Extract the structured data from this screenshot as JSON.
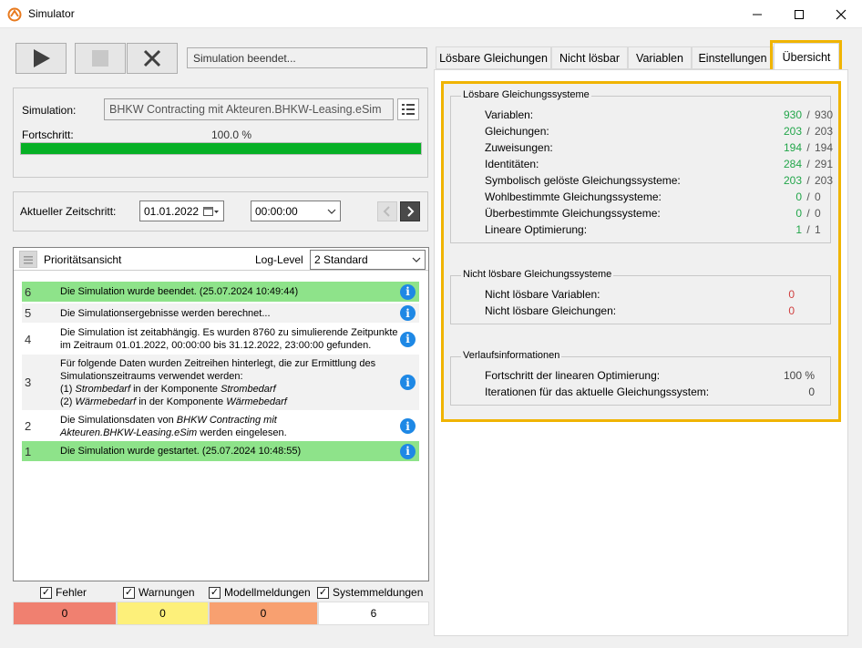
{
  "window": {
    "title": "Simulator"
  },
  "toolbar": {
    "status": "Simulation beendet..."
  },
  "simulation": {
    "label": "Simulation:",
    "file": "BHKW Contracting mit Akteuren.BHKW-Leasing.eSim",
    "progress_label": "Fortschritt:",
    "progress_text": "100.0 %",
    "progress_value": 1.0
  },
  "timestep": {
    "label": "Aktueller Zeitschritt:",
    "date": "01.01.2022",
    "time": "00:00:00"
  },
  "log": {
    "header": "Prioritätsansicht",
    "level_label": "Log-Level",
    "level_value": "2 Standard",
    "entries": [
      {
        "num": "6",
        "lines": [
          "Die Simulation wurde beendet. (25.07.2024 10:49:44)"
        ]
      },
      {
        "num": "5",
        "lines": [
          "Die Simulationsergebnisse werden berechnet..."
        ]
      },
      {
        "num": "4",
        "lines": [
          "Die Simulation ist zeitabhängig. Es wurden 8760 zu simulierende Zeitpunkte",
          "im Zeitraum 01.01.2022, 00:00:00 bis 31.12.2022, 23:00:00 gefunden."
        ]
      },
      {
        "num": "3",
        "lines": [
          "Für folgende Daten wurden Zeitreihen hinterlegt, die zur Ermittlung des",
          "Simulationszeitraums verwendet werden:"
        ],
        "items": [
          {
            "prefix": "(1) ",
            "a": "Strombedarf",
            "mid": " in der Komponente ",
            "b": "Strombedarf"
          },
          {
            "prefix": "(2) ",
            "a": "Wärmebedarf",
            "mid": " in der Komponente ",
            "b": "Wärmebedarf"
          }
        ]
      },
      {
        "num": "2",
        "pre": "Die Simulationsdaten von ",
        "italic": "BHKW Contracting mit",
        "line2_italic": "Akteuren.BHKW-Leasing.eSim",
        "line2_post": " werden eingelesen."
      },
      {
        "num": "1",
        "lines": [
          "Die Simulation wurde gestartet. (25.07.2024 10:48:55)"
        ]
      }
    ],
    "filters": [
      {
        "label": "Fehler",
        "count": "0"
      },
      {
        "label": "Warnungen",
        "count": "0"
      },
      {
        "label": "Modellmeldungen",
        "count": "0"
      },
      {
        "label": "Systemmeldungen",
        "count": "6"
      }
    ]
  },
  "tabs": [
    "Lösbare Gleichungen",
    "Nicht lösbar",
    "Variablen",
    "Einstellungen",
    "Übersicht"
  ],
  "overview": {
    "solvable": {
      "title": "Lösbare Gleichungssysteme",
      "rows": [
        {
          "label": "Variablen:",
          "value": "930",
          "total": "930"
        },
        {
          "label": "Gleichungen:",
          "value": "203",
          "total": "203"
        },
        {
          "label": "Zuweisungen:",
          "value": "194",
          "total": "194"
        },
        {
          "label": "Identitäten:",
          "value": "284",
          "total": "291"
        },
        {
          "label": "Symbolisch gelöste Gleichungssysteme:",
          "value": "203",
          "total": "203"
        },
        {
          "label": "Wohlbestimmte Gleichungssysteme:",
          "value": "0",
          "total": "0"
        },
        {
          "label": "Überbestimmte Gleichungssysteme:",
          "value": "0",
          "total": "0"
        },
        {
          "label": "Lineare Optimierung:",
          "value": "1",
          "total": "1"
        }
      ],
      "separator": "/"
    },
    "unsolvable": {
      "title": "Nicht lösbare Gleichungssysteme",
      "rows": [
        {
          "label": "Nicht lösbare Variablen:",
          "value": "0"
        },
        {
          "label": "Nicht lösbare Gleichungen:",
          "value": "0"
        }
      ]
    },
    "progress": {
      "title": "Verlaufsinformationen",
      "rows": [
        {
          "label": "Fortschritt der linearen Optimierung:",
          "value": "100 %"
        },
        {
          "label": "Iterationen für das aktuelle Gleichungssystem:",
          "value": "0"
        }
      ]
    }
  },
  "colors": {
    "highlight": "#f0b400",
    "success_row": "#8ee38a",
    "progress": "#06b025",
    "error": "#f08070",
    "warning": "#fdf07a",
    "model": "#f8a070"
  }
}
